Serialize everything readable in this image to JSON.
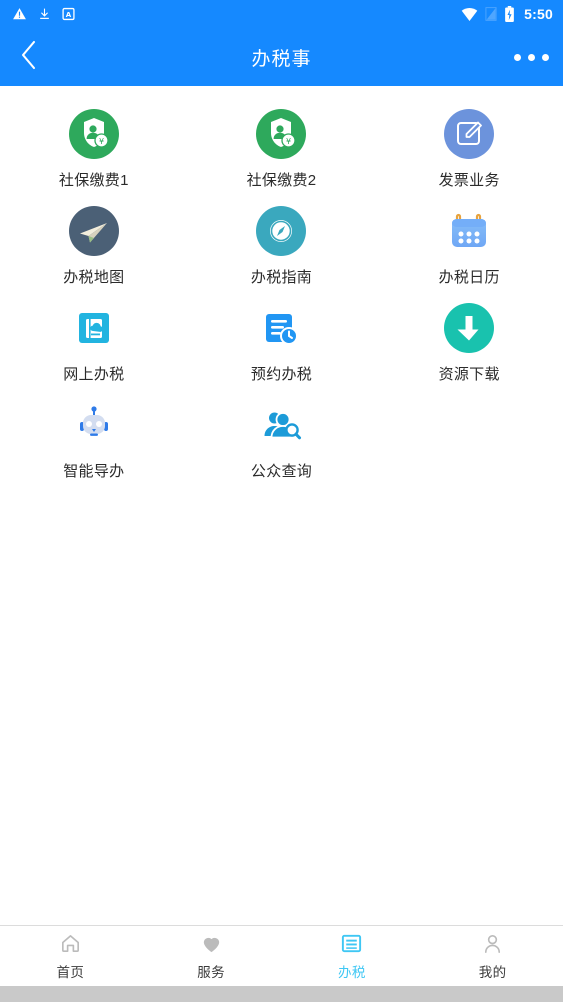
{
  "status_bar": {
    "icons_left": [
      "warning-triangle-icon",
      "download-icon",
      "boxed-a-icon"
    ],
    "icons_right": [
      "wifi-icon",
      "signal-off-icon",
      "battery-charging-icon"
    ],
    "time": "5:50"
  },
  "header": {
    "title": "办税事",
    "back_icon": "chevron-left-icon",
    "more_icon": "more-horizontal-icon"
  },
  "colors": {
    "header_bg": "#1589FF",
    "active_tab": "#3FC7F4",
    "label_text": "#2b2b2b"
  },
  "grid": {
    "items": [
      {
        "label": "社保缴费1",
        "icon": "social-security-payment-icon",
        "color": "#2EA95C"
      },
      {
        "label": "社保缴费2",
        "icon": "social-security-payment-icon",
        "color": "#2EA95C"
      },
      {
        "label": "发票业务",
        "icon": "invoice-edit-icon",
        "color": "#6C93DC"
      },
      {
        "label": "办税地图",
        "icon": "paper-plane-map-icon",
        "color": "#4B6076"
      },
      {
        "label": "办税指南",
        "icon": "compass-guide-icon",
        "color": "#3AA8BE"
      },
      {
        "label": "办税日历",
        "icon": "calendar-icon",
        "color": "#5EA8F7"
      },
      {
        "label": "网上办税",
        "icon": "online-tax-document-icon",
        "color": "#22B4E0"
      },
      {
        "label": "预约办税",
        "icon": "appointment-clock-document-icon",
        "color": "#2196F3"
      },
      {
        "label": "资源下载",
        "icon": "download-circle-icon",
        "color": "#19C2AE"
      },
      {
        "label": "智能导办",
        "icon": "robot-assistant-icon",
        "color": "#9FB6D8"
      },
      {
        "label": "公众查询",
        "icon": "public-search-people-icon",
        "color": "#1C9BD8"
      }
    ]
  },
  "tabbar": {
    "items": [
      {
        "label": "首页",
        "icon": "home-icon",
        "active": false
      },
      {
        "label": "服务",
        "icon": "heart-icon",
        "active": false
      },
      {
        "label": "办税",
        "icon": "list-icon",
        "active": true
      },
      {
        "label": "我的",
        "icon": "person-icon",
        "active": false
      }
    ]
  }
}
